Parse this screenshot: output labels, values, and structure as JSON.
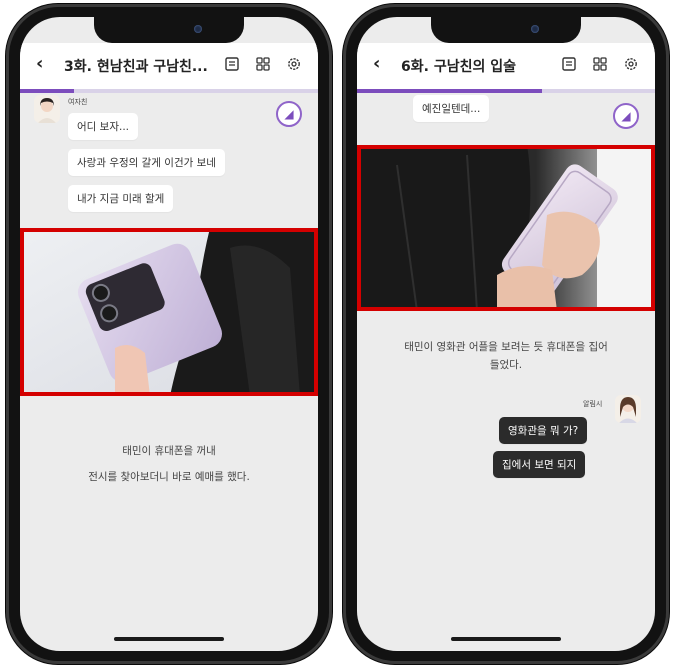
{
  "left_phone": {
    "header": {
      "back_icon": "chevron-left-icon",
      "title": "3화. 현남친과 구남친..."
    },
    "header_icons": [
      "list-icon",
      "grid-icon",
      "gear-icon"
    ],
    "progress": 0.18,
    "speaker_name": "여자친",
    "bubbles": [
      "어디 보자...",
      "사랑과 우정의 갈게 이건가 보네",
      "내가 지금 미래 할게"
    ],
    "narration": [
      "태민이 휴대폰을 꺼내",
      "전시를 찾아보더니 바로 예매를 했다."
    ]
  },
  "right_phone": {
    "header": {
      "back_icon": "chevron-left-icon",
      "title": "6화. 구남친의 입술"
    },
    "header_icons": [
      "list-icon",
      "grid-icon",
      "gear-icon"
    ],
    "progress": 0.62,
    "top_bubble": "예진일텐데...",
    "narration": [
      "태민이 영화관 어플을 보려는 듯 휴대폰을 집어",
      "들었다."
    ],
    "speaker_name": "알림시",
    "bubbles": [
      "영화관을 뭐 가?",
      "집에서 보면 되지"
    ]
  },
  "colors": {
    "accent": "#7c4dbd",
    "highlight_red": "#d40000",
    "dark_bubble": "#2b2b2b"
  }
}
